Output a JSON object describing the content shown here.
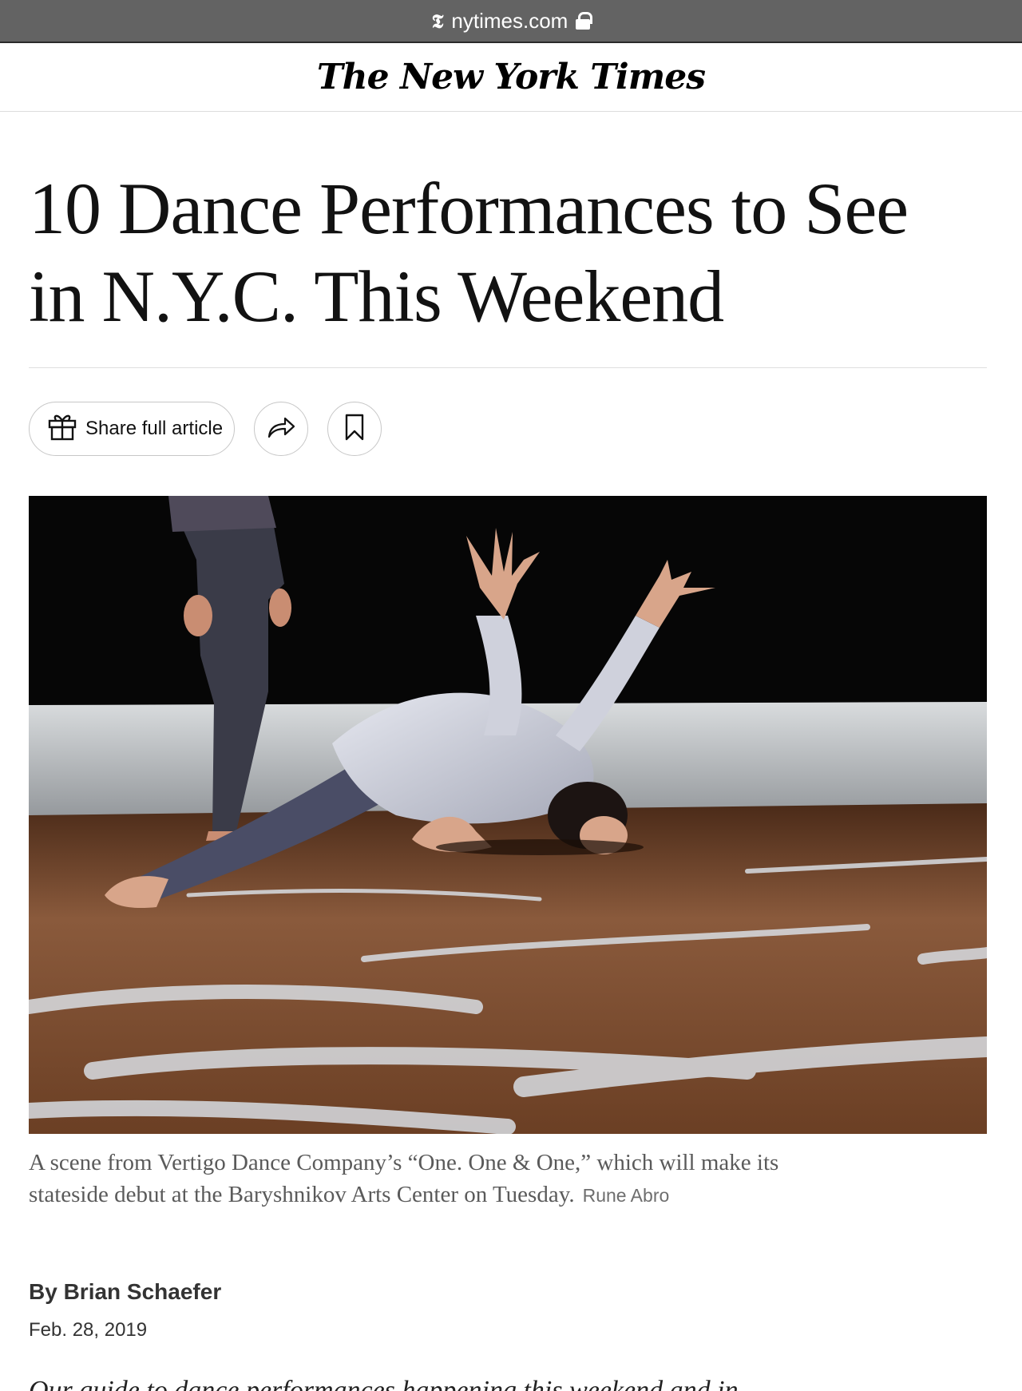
{
  "browser": {
    "domain": "nytimes.com"
  },
  "masthead": {
    "logo_text": "The New York Times"
  },
  "article": {
    "headline_line1": "10 Dance Performances to See",
    "headline_line2": "in N.Y.C. This Weekend",
    "actions": {
      "share_full_label": "Share full article"
    },
    "caption": {
      "text_line1": "A scene from Vertigo Dance Company’s “One. One & One,” which will make its",
      "text_line2": "stateside debut at the Baryshnikov Arts Center on Tuesday.",
      "credit": "Rune Abro"
    },
    "byline": "By Brian Schaefer",
    "date": "Feb. 28, 2019",
    "body_partial": "Our guide to dance performances happening this weekend and in"
  },
  "colors": {
    "url_bar_bg": "#636363",
    "text": "#121212",
    "caption": "#5a5a5a",
    "border": "#c7c7c7"
  },
  "icons": [
    "nyt-t-icon",
    "lock-icon",
    "gift-icon",
    "share-arrow-icon",
    "bookmark-icon"
  ]
}
